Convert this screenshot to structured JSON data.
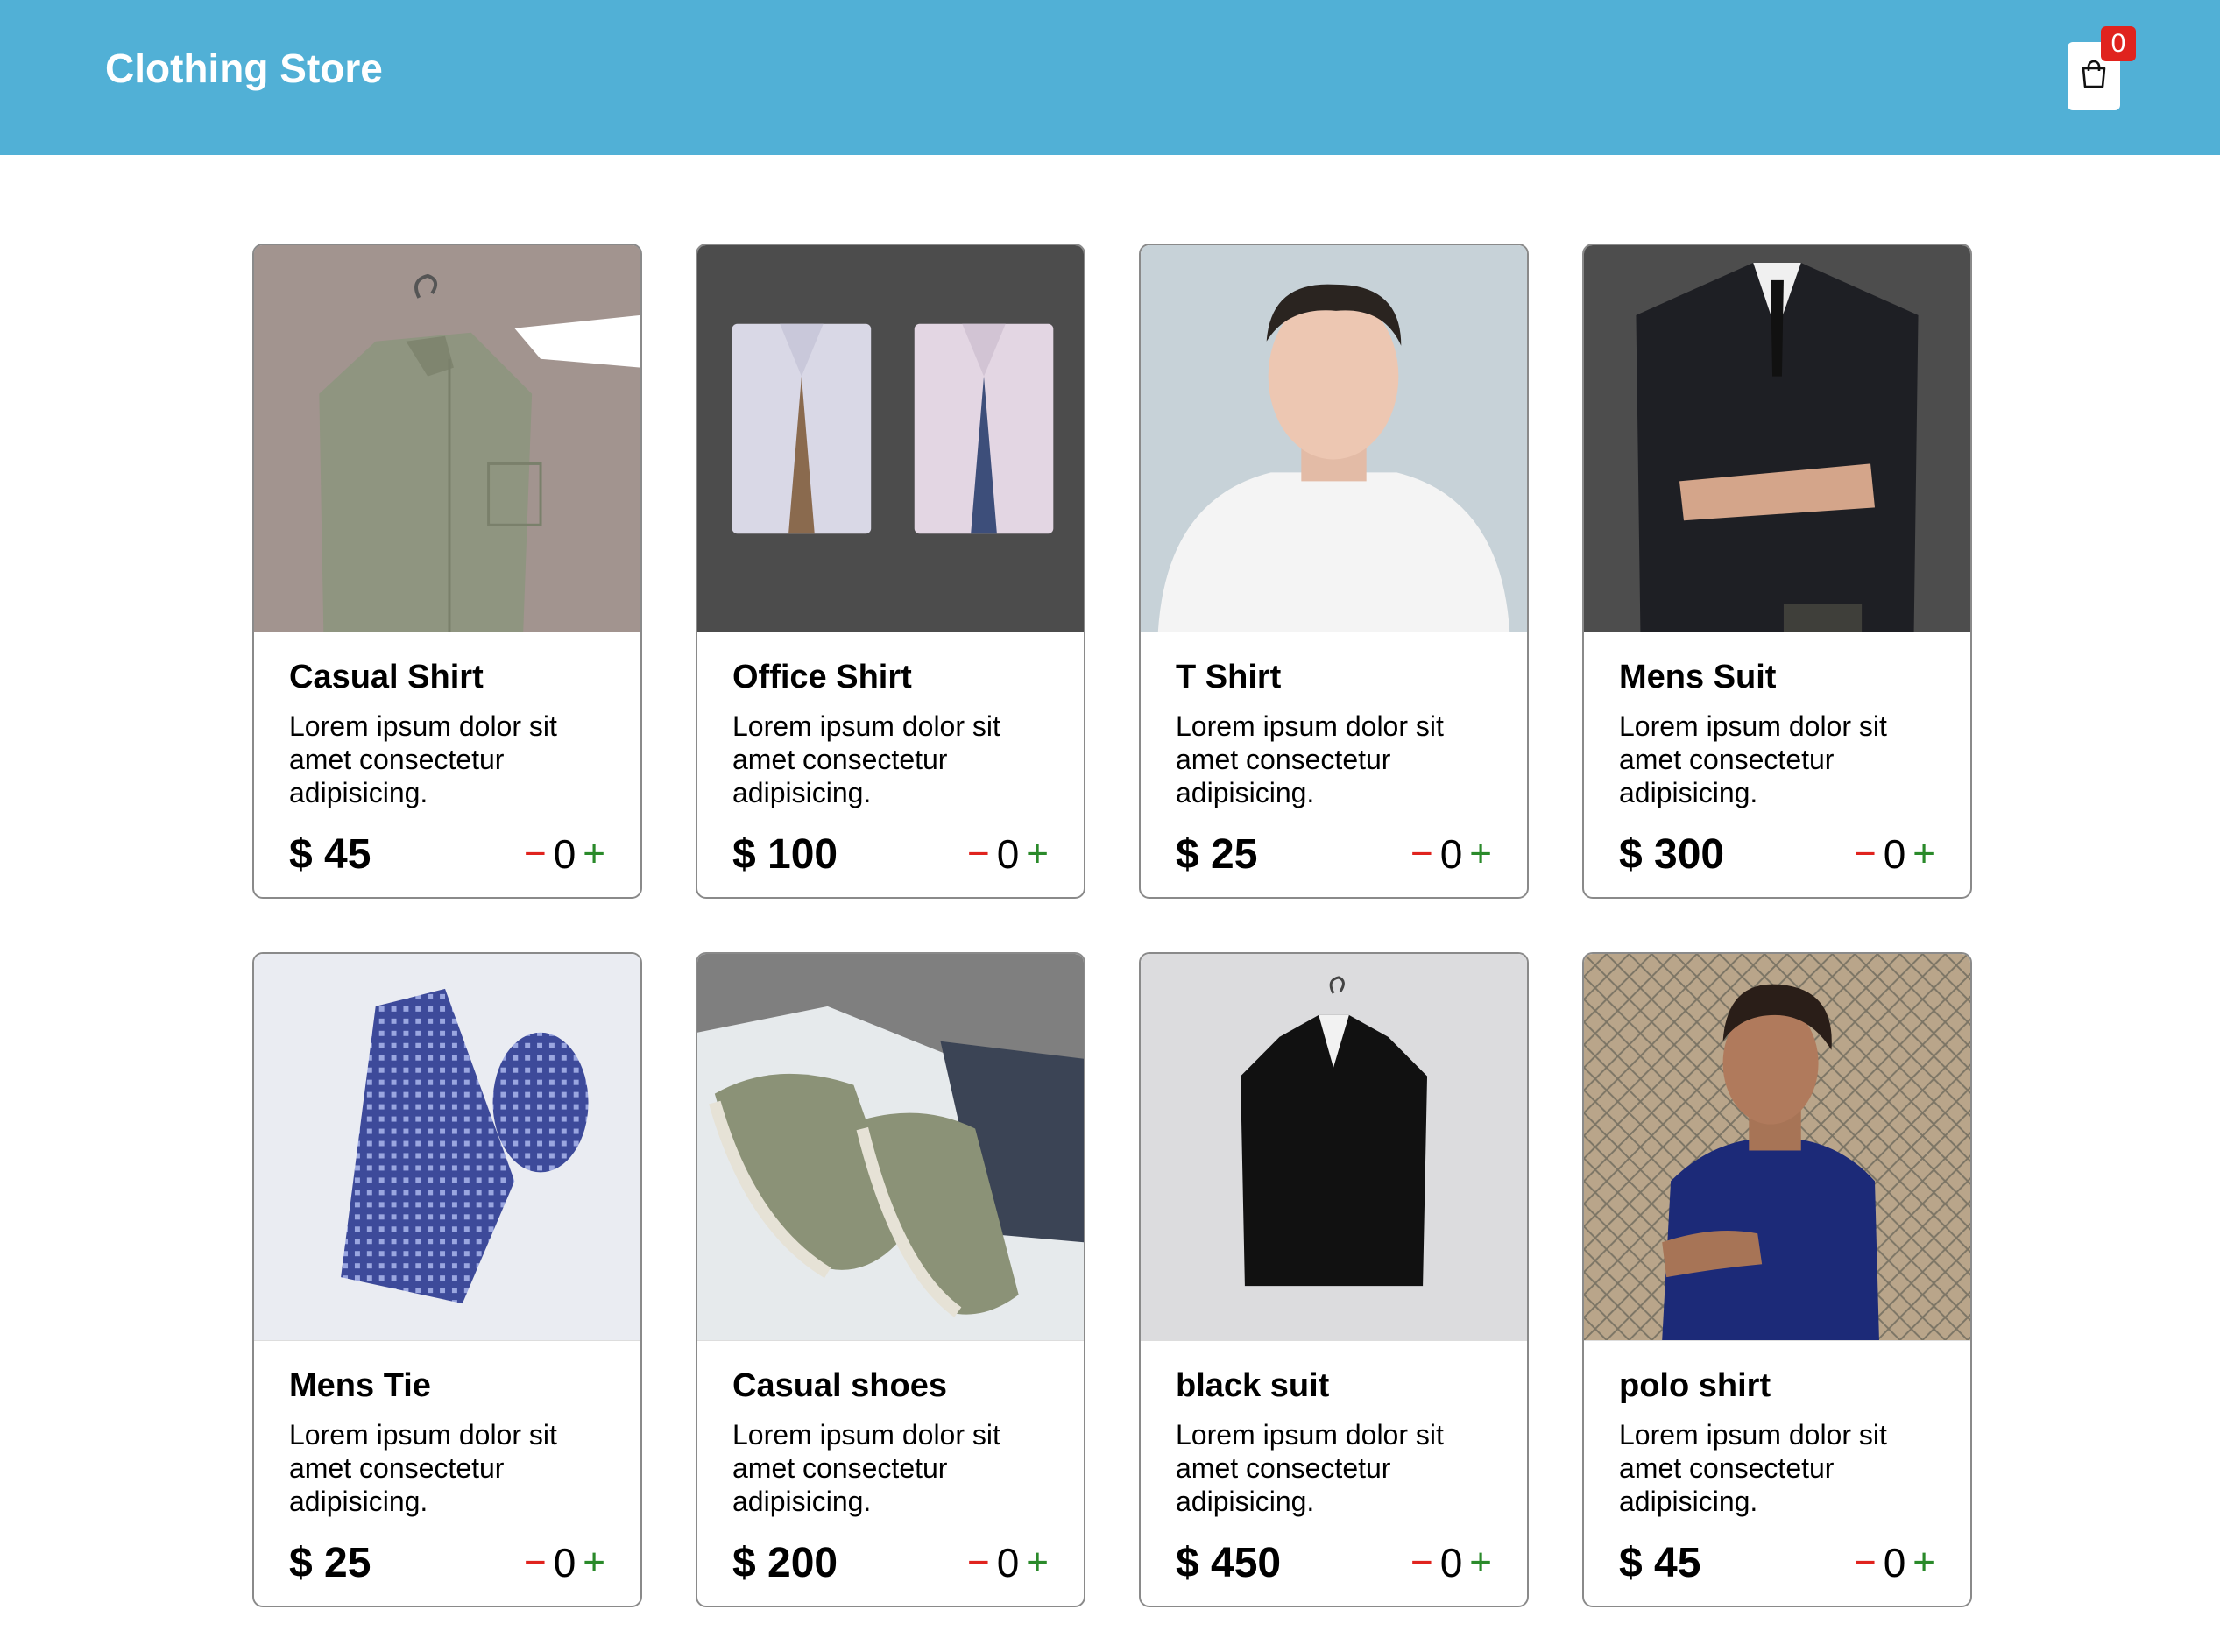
{
  "header": {
    "brand": "Clothing Store",
    "cart_icon": "shopping-bag-icon",
    "cart_count": "0"
  },
  "colors": {
    "navbar": "#51b0d6",
    "badge": "#e0231e",
    "minus": "#e0231e",
    "plus": "#2a8a2a"
  },
  "controls": {
    "minus": "−",
    "plus": "+"
  },
  "products": [
    {
      "name": "Casual Shirt",
      "description": "Lorem ipsum dolor sit amet consectetur adipisicing.",
      "price": "$ 45",
      "quantity": "0",
      "image": "olive-shirt-on-hanger-photo"
    },
    {
      "name": "Office Shirt",
      "description": "Lorem ipsum dolor sit amet consectetur adipisicing.",
      "price": "$ 100",
      "quantity": "0",
      "image": "two-folded-shirts-with-ties-photo"
    },
    {
      "name": "T Shirt",
      "description": "Lorem ipsum dolor sit amet consectetur adipisicing.",
      "price": "$ 25",
      "quantity": "0",
      "image": "man-in-white-tshirt-photo"
    },
    {
      "name": "Mens Suit",
      "description": "Lorem ipsum dolor sit amet consectetur adipisicing.",
      "price": "$ 300",
      "quantity": "0",
      "image": "man-in-dark-suit-photo"
    },
    {
      "name": "Mens Tie",
      "description": "Lorem ipsum dolor sit amet consectetur adipisicing.",
      "price": "$ 25",
      "quantity": "0",
      "image": "blue-patterned-tie-photo"
    },
    {
      "name": "Casual shoes",
      "description": "Lorem ipsum dolor sit amet consectetur adipisicing.",
      "price": "$ 200",
      "quantity": "0",
      "image": "green-sneakers-photo"
    },
    {
      "name": "black suit",
      "description": "Lorem ipsum dolor sit amet consectetur adipisicing.",
      "price": "$ 450",
      "quantity": "0",
      "image": "black-suit-on-hanger-photo"
    },
    {
      "name": "polo shirt",
      "description": "Lorem ipsum dolor sit amet consectetur adipisicing.",
      "price": "$ 45",
      "quantity": "0",
      "image": "man-in-navy-polo-photo"
    }
  ]
}
